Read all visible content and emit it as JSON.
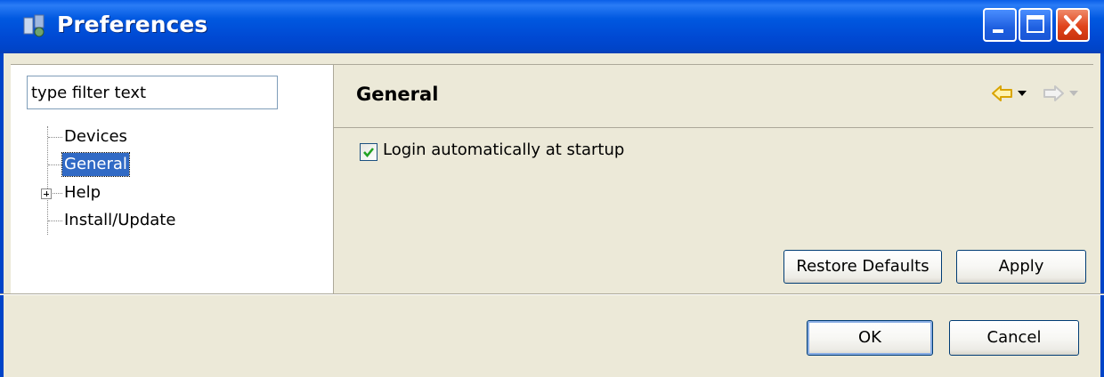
{
  "window": {
    "title": "Preferences",
    "accent_color": "#0054e3",
    "buttons": [
      "minimize",
      "maximize",
      "close"
    ]
  },
  "sidebar": {
    "filter_value": "type filter text",
    "tree": [
      {
        "label": "Devices",
        "selected": false,
        "expandable": false
      },
      {
        "label": "General",
        "selected": true,
        "expandable": false
      },
      {
        "label": "Help",
        "selected": false,
        "expandable": true
      },
      {
        "label": "Install/Update",
        "selected": false,
        "expandable": false
      }
    ],
    "selection_color": "#316ac5"
  },
  "page": {
    "title": "General",
    "nav_icons": [
      "back-arrow-icon",
      "forward-arrow-icon"
    ],
    "checkbox": {
      "label": "Login automatically at startup",
      "checked": true
    },
    "restore_defaults_label": "Restore Defaults",
    "apply_label": "Apply"
  },
  "footer": {
    "ok_label": "OK",
    "cancel_label": "Cancel"
  }
}
